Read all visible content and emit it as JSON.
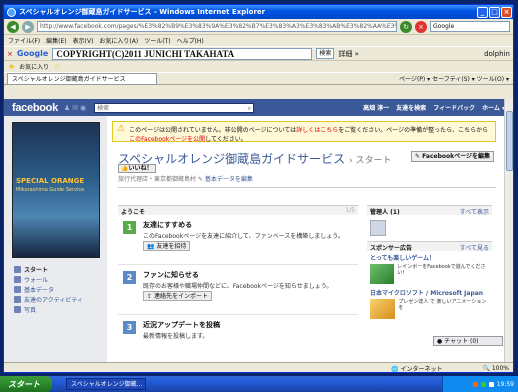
{
  "window": {
    "title": "スペシャルオレンジ御蔵島ガイドサービス - Windows Internet Explorer",
    "controls": [
      "_",
      "□",
      "×"
    ]
  },
  "address": {
    "url": "http://www.facebook.com/pages/%E3%82%B9%E3%83%9A%E3%82%B7%E3%83%A3%E3%83%AB%E3%82%AA%E3%83%AC%E3%83%B3%E3%82%B8",
    "search_placeholder": "Google"
  },
  "menu": [
    "ファイル(F)",
    "編集(E)",
    "表示(V)",
    "お気に入り(A)",
    "ツール(T)",
    "ヘルプ(H)"
  ],
  "google_bar": {
    "logo": "Google",
    "query": "COPYRIGHT(C)2011 JUNICHI TAKAHATA",
    "search_label": "検索",
    "more_label": "詳細 »",
    "user": "dolphin"
  },
  "favorites": {
    "label": "お気に入り"
  },
  "tab": {
    "title": "スペシャルオレンジ御蔵島ガイドサービス",
    "tools": "ページ(P) ▾  セーフティ(S) ▾  ツール(O) ▾"
  },
  "facebook": {
    "logo": "facebook",
    "search_placeholder": "検索",
    "nav": [
      "高畑 淳一",
      "友達を検索",
      "フィードバック",
      "ホーム ▾"
    ]
  },
  "cover": {
    "brand": "SPECIAL ORANGE",
    "sub": "Mikurashima Guide Service"
  },
  "sidenav": [
    {
      "label": "スタート",
      "active": true
    },
    {
      "label": "ウォール",
      "active": false
    },
    {
      "label": "基本データ",
      "active": false
    },
    {
      "label": "友達のアクティビティ",
      "active": false
    },
    {
      "label": "写真",
      "active": false
    }
  ],
  "notice": {
    "text1": "このページは公開されていません。非公開のページについては",
    "link1": "詳しくはこちら",
    "text2": "をご覧ください。ページの準備が整ったら、こちらから",
    "link2": "このFacebookページを公開",
    "text3": "してください。"
  },
  "page": {
    "title": "スペシャルオレンジ御蔵島ガイドサービス",
    "subtitle": "› スタート",
    "like": "いいね！",
    "edit": "Facebookページを編集",
    "meta_prefix": "旅行代理店・東京都御蔵島村",
    "meta_link": "基本データを編集"
  },
  "welcome": {
    "title": "ようこそ",
    "count": "1/5",
    "steps": [
      {
        "num": "1",
        "title": "友達にすすめる",
        "desc": "このFacebookページを友達に紹介して、ファンベースを構築しましょう。",
        "button": "友達を招待",
        "color": "#5aa94a"
      },
      {
        "num": "2",
        "title": "ファンに知らせる",
        "desc": "既存のお客様や職場仲間などに、Facebookページを知らせましょう。",
        "button": "連絡先をインポート",
        "color": "#5b8ac7"
      },
      {
        "num": "3",
        "title": "近況アップデートを投稿",
        "desc": "最新情報を投稿します。",
        "button": "",
        "color": "#5b8ac7"
      }
    ]
  },
  "sidebar_right": {
    "admins": {
      "title": "管理人 (1)",
      "link": "すべて表示"
    },
    "ads": {
      "title": "スポンサー広告",
      "link": "すべて見る"
    },
    "ad1": {
      "title": "とっても楽しいゲーム！",
      "text": "レインボーをFacebookで遊んでください！"
    },
    "ad2": {
      "title": "日本マイクロソフト / Microsoft Japan",
      "text": "プレゼン達人 で 楽しいアニメーションを"
    }
  },
  "chat": {
    "label": "チャット (0)"
  },
  "status": {
    "zone": "インターネット",
    "zoom": "100%"
  },
  "taskbar": {
    "start": "スタート",
    "item": "スペシャルオレンジ御蔵...",
    "clock": "19:59"
  }
}
